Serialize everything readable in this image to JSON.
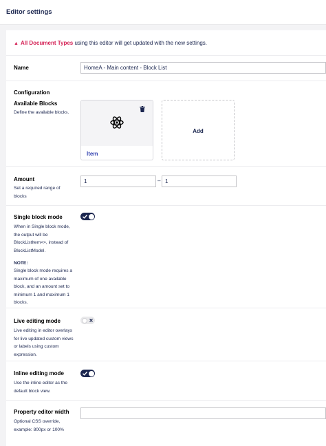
{
  "header": {
    "title": "Editor settings"
  },
  "notice": {
    "icon": "warning-icon",
    "highlight": "All Document Types",
    "text": " using this editor will get updated with the new settings."
  },
  "name_field": {
    "label": "Name",
    "value": "HomeA - Main content - Block List"
  },
  "configuration": {
    "heading": "Configuration"
  },
  "available_blocks": {
    "label": "Available Blocks",
    "description": "Define the available blocks.",
    "blocks": [
      {
        "label": "Item",
        "icon": "atom-icon"
      }
    ],
    "add_label": "Add"
  },
  "amount": {
    "label": "Amount",
    "description": "Set a required range of blocks",
    "min": "1",
    "max": "1",
    "separator": "–"
  },
  "single_block_mode": {
    "label": "Single block mode",
    "description": "When in Single block mode, the output will be BlockListItem<>, instead of BlockListModel.",
    "note_title": "NOTE:",
    "note_text": "Single block mode requires a maximum of one available block, and an amount set to minimum 1 and maximum 1 blocks.",
    "enabled": true
  },
  "live_editing_mode": {
    "label": "Live editing mode",
    "description": "Live editing in editor overlays for live updated custom views or labels using custom expression.",
    "enabled": false
  },
  "inline_editing_mode": {
    "label": "Inline editing mode",
    "description": "Use the inline editor as the default block view.",
    "enabled": true
  },
  "property_editor_width": {
    "label": "Property editor width",
    "description": "Optional CSS override, example: 800px or 100%",
    "value": ""
  },
  "colors": {
    "primary": "#1b264f",
    "accent_link": "#3544b1",
    "warning": "#d42054",
    "background": "#f3f3f5"
  }
}
